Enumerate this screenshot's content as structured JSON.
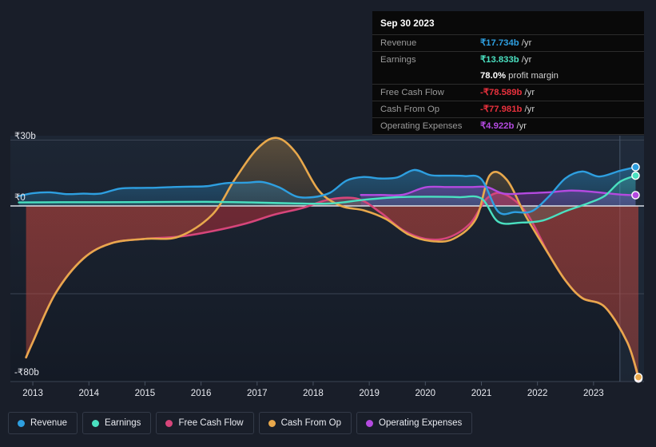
{
  "background": "#191e29",
  "tooltip": {
    "date": "Sep 30 2023",
    "rows": [
      {
        "label": "Revenue",
        "value": "₹17.734b",
        "unit": "/yr",
        "color": "#2e9fe0"
      },
      {
        "label": "Earnings",
        "value": "₹13.833b",
        "unit": "/yr",
        "color": "#4ae0c0"
      },
      {
        "label": "",
        "value": "78.0%",
        "unit": "profit margin",
        "color": "#ffffff"
      },
      {
        "label": "Free Cash Flow",
        "value": "-₹78.589b",
        "unit": "/yr",
        "color": "#e8313d"
      },
      {
        "label": "Cash From Op",
        "value": "-₹77.981b",
        "unit": "/yr",
        "color": "#e8313d"
      },
      {
        "label": "Operating Expenses",
        "value": "₹4.922b",
        "unit": "/yr",
        "color": "#b44ae0"
      }
    ]
  },
  "legend": {
    "items": [
      {
        "label": "Revenue",
        "color": "#2e9fe0"
      },
      {
        "label": "Earnings",
        "color": "#4ae0c0"
      },
      {
        "label": "Free Cash Flow",
        "color": "#d6457a"
      },
      {
        "label": "Cash From Op",
        "color": "#e8a84c"
      },
      {
        "label": "Operating Expenses",
        "color": "#b44ae0"
      }
    ]
  },
  "chart_data": {
    "type": "area",
    "title": "",
    "xlabel": "",
    "ylabel": "",
    "currency": "₹",
    "unit": "b",
    "grid": true,
    "legend_position": "bottom",
    "ylim": [
      -85,
      32
    ],
    "yticks": [
      30,
      0,
      -40,
      -80
    ],
    "ytick_labels": [
      "₹30b",
      "₹0",
      "",
      "-₹80b"
    ],
    "xlim": [
      2012.6,
      2023.9
    ],
    "xticks": [
      2013,
      2014,
      2015,
      2016,
      2017,
      2018,
      2019,
      2020,
      2021,
      2022,
      2023
    ],
    "xtick_labels": [
      "2013",
      "2014",
      "2015",
      "2016",
      "2017",
      "2018",
      "2019",
      "2020",
      "2021",
      "2022",
      "2023"
    ],
    "highlight_x": 2023.47,
    "series": [
      {
        "name": "Revenue",
        "color": "#2e9fe0",
        "x": [
          2012.75,
          2013.0,
          2013.3,
          2013.6,
          2013.9,
          2014.2,
          2014.55,
          2014.9,
          2015.2,
          2015.5,
          2015.8,
          2016.1,
          2016.45,
          2016.8,
          2017.1,
          2017.4,
          2017.7,
          2018.0,
          2018.3,
          2018.6,
          2018.9,
          2019.2,
          2019.5,
          2019.8,
          2020.1,
          2020.4,
          2020.7,
          2021.0,
          2021.3,
          2021.6,
          2021.9,
          2022.2,
          2022.5,
          2022.8,
          2023.1,
          2023.47,
          2023.75
        ],
        "values": [
          4.5,
          5.8,
          6.2,
          5.4,
          5.6,
          5.6,
          7.9,
          8.2,
          8.3,
          8.6,
          8.8,
          9.0,
          10.4,
          10.6,
          10.9,
          8.4,
          4.3,
          4.0,
          6.0,
          11.6,
          13.2,
          12.5,
          13.0,
          16.4,
          14.0,
          13.8,
          13.6,
          12.2,
          -2.6,
          -2.8,
          -2.4,
          4.2,
          12.6,
          15.7,
          13.4,
          16.0,
          17.7
        ],
        "end_marker": true
      },
      {
        "name": "Earnings",
        "color": "#4ae0c0",
        "x": [
          2012.75,
          2013.5,
          2014.3,
          2015.2,
          2016.1,
          2016.9,
          2017.6,
          2018.3,
          2018.9,
          2019.5,
          2020.1,
          2020.6,
          2021.0,
          2021.3,
          2021.7,
          2022.1,
          2022.5,
          2022.9,
          2023.2,
          2023.47,
          2023.75
        ],
        "values": [
          1.6,
          1.7,
          1.7,
          1.8,
          1.9,
          1.6,
          1.2,
          1.1,
          2.8,
          4.0,
          4.2,
          4.0,
          3.4,
          -7.2,
          -7.6,
          -6.6,
          -2.4,
          1.2,
          4.6,
          11.0,
          13.8
        ],
        "end_marker": true
      },
      {
        "name": "Free Cash Flow",
        "color": "#d6457a",
        "x": [
          2012.88,
          2013.0,
          2013.4,
          2013.9,
          2014.4,
          2015.0,
          2015.6,
          2016.2,
          2016.8,
          2017.3,
          2017.8,
          2018.3,
          2018.8,
          2019.2,
          2019.6,
          2020.0,
          2020.4,
          2020.8,
          2021.1,
          2021.4,
          2021.8,
          2022.2,
          2022.5,
          2022.8,
          2023.2,
          2023.6,
          2023.8
        ],
        "values": [
          -69.0,
          -62.0,
          -40.0,
          -24.0,
          -17.0,
          -15.0,
          -14.0,
          -11.5,
          -8.0,
          -4.0,
          -1.0,
          3.0,
          3.2,
          -3.0,
          -11.0,
          -15.0,
          -14.5,
          -8.0,
          3.5,
          5.5,
          -3.0,
          -22.0,
          -34.0,
          -42.0,
          -46.0,
          -62.0,
          -78.6
        ],
        "end_marker": true
      },
      {
        "name": "Cash From Op",
        "color": "#e8a84c",
        "x": [
          2012.88,
          2013.0,
          2013.4,
          2013.9,
          2014.4,
          2015.0,
          2015.6,
          2016.2,
          2016.6,
          2017.0,
          2017.35,
          2017.7,
          2018.1,
          2018.5,
          2018.9,
          2019.3,
          2019.7,
          2020.1,
          2020.5,
          2020.9,
          2021.15,
          2021.45,
          2021.8,
          2022.2,
          2022.5,
          2022.8,
          2023.2,
          2023.6,
          2023.8
        ],
        "values": [
          -69.0,
          -62.0,
          -40.0,
          -24.0,
          -17.0,
          -15.0,
          -14.0,
          -4.0,
          12.0,
          26.0,
          31.0,
          24.0,
          7.0,
          0.0,
          -2.0,
          -6.0,
          -13.0,
          -16.0,
          -15.0,
          -6.0,
          14.0,
          12.0,
          -5.0,
          -22.0,
          -34.0,
          -42.0,
          -46.0,
          -62.0,
          -78.0
        ],
        "end_marker": true
      },
      {
        "name": "Operating Expenses",
        "color": "#b44ae0",
        "x": [
          2018.85,
          2019.2,
          2019.6,
          2020.0,
          2020.4,
          2020.8,
          2021.1,
          2021.4,
          2021.8,
          2022.2,
          2022.6,
          2023.0,
          2023.47,
          2023.75
        ],
        "values": [
          5.0,
          5.0,
          5.1,
          8.5,
          8.6,
          8.6,
          8.6,
          5.6,
          5.8,
          6.2,
          7.0,
          6.4,
          5.2,
          4.9
        ],
        "end_marker": true
      }
    ]
  }
}
